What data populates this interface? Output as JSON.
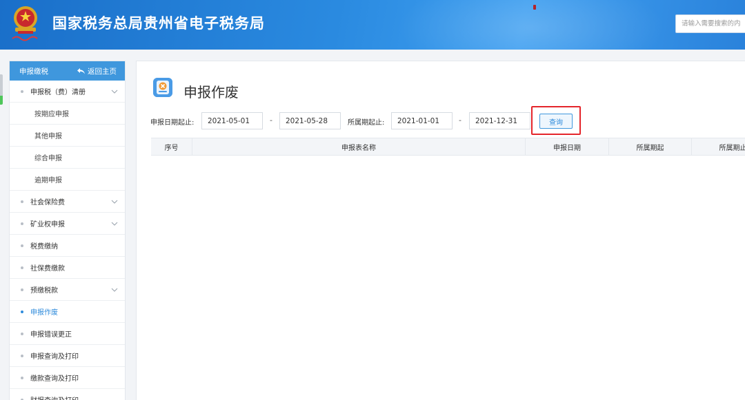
{
  "header": {
    "title": "国家税务总局贵州省电子税务局",
    "search_placeholder": "请输入需要搜索的内",
    "brand_color": "#2a82db"
  },
  "sidebar": {
    "section_title": "申报缴税",
    "back_label": "返回主页",
    "items": [
      {
        "label": "申报税（费）清册",
        "level": 1,
        "expandable": true
      },
      {
        "label": "按期应申报",
        "level": 2
      },
      {
        "label": "其他申报",
        "level": 2
      },
      {
        "label": "综合申报",
        "level": 2
      },
      {
        "label": "逾期申报",
        "level": 2
      },
      {
        "label": "社会保险费",
        "level": 1,
        "expandable": true
      },
      {
        "label": "矿业权申报",
        "level": 1,
        "expandable": true
      },
      {
        "label": "税费缴纳",
        "level": 1
      },
      {
        "label": "社保费缴款",
        "level": 1
      },
      {
        "label": "预缴税款",
        "level": 1,
        "expandable": true
      },
      {
        "label": "申报作废",
        "level": 1,
        "active": true
      },
      {
        "label": "申报错误更正",
        "level": 1
      },
      {
        "label": "申报查询及打印",
        "level": 1
      },
      {
        "label": "缴款查询及打印",
        "level": 1
      },
      {
        "label": "财报查询及打印",
        "level": 1
      }
    ]
  },
  "main": {
    "page_title": "申报作废",
    "filters": {
      "declare_date_label": "申报日期起止:",
      "declare_date_start": "2021-05-01",
      "declare_date_end": "2021-05-28",
      "period_label": "所属期起止:",
      "period_start": "2021-01-01",
      "period_end": "2021-12-31",
      "separator": "-",
      "query_label": "查询"
    },
    "table": {
      "columns": [
        "序号",
        "申报表名称",
        "申报日期",
        "所属期起",
        "所属期止"
      ],
      "rows": []
    }
  }
}
